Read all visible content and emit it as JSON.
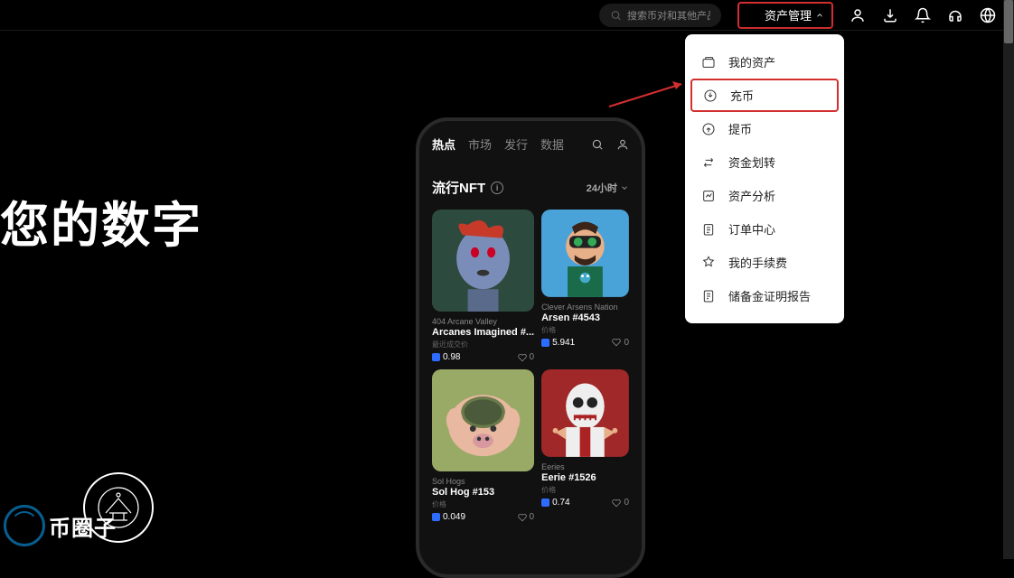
{
  "topbar": {
    "search_placeholder": "搜索币对和其他产品",
    "asset_trigger_label": "资产管理"
  },
  "dropdown": {
    "items": [
      {
        "icon": "wallet",
        "label": "我的资产"
      },
      {
        "icon": "deposit",
        "label": "充币",
        "highlighted": true
      },
      {
        "icon": "withdraw",
        "label": "提币"
      },
      {
        "icon": "transfer",
        "label": "资金划转"
      },
      {
        "icon": "analysis",
        "label": "资产分析"
      },
      {
        "icon": "orders",
        "label": "订单中心"
      },
      {
        "icon": "fees",
        "label": "我的手续费"
      },
      {
        "icon": "report",
        "label": "储备金证明报告"
      }
    ]
  },
  "hero": {
    "text": "您的数字"
  },
  "watermark": {
    "text": "币圈子"
  },
  "phone": {
    "tabs": [
      "热点",
      "市场",
      "发行",
      "数据"
    ],
    "active_tab": 0,
    "section_title": "流行NFT",
    "time_filter": "24小时",
    "nfts": [
      {
        "collection": "404 Arcane Valley",
        "name": "Arcanes Imagined #...",
        "sub": "最近成交价",
        "price": "0.98",
        "likes": "0"
      },
      {
        "collection": "Clever Arsens Nation",
        "name": "Arsen #4543",
        "sub": "价格",
        "price": "5.941",
        "likes": "0"
      },
      {
        "collection": "Sol Hogs",
        "name": "Sol Hog #153",
        "sub": "价格",
        "price": "0.049",
        "likes": "0"
      },
      {
        "collection": "Eeries",
        "name": "Eerie #1526",
        "sub": "价格",
        "price": "0.74",
        "likes": "0"
      }
    ]
  }
}
